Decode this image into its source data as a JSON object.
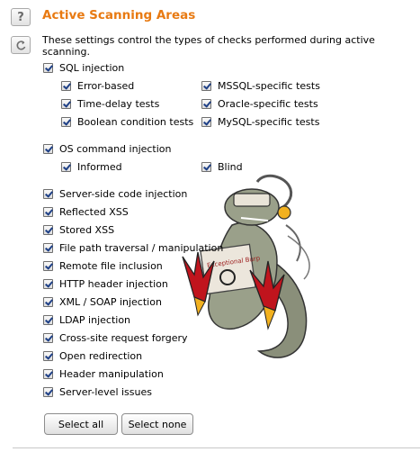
{
  "icons": {
    "help": "question-icon",
    "refresh": "refresh-icon"
  },
  "accent": "#e87a12",
  "title": "Active Scanning Areas",
  "description": "These settings control the types of checks performed during active scanning.",
  "sql": {
    "label": "SQL injection",
    "error_based": "Error-based",
    "time_delay": "Time-delay tests",
    "boolean": "Boolean condition tests",
    "mssql": "MSSQL-specific tests",
    "oracle": "Oracle-specific tests",
    "mysql": "MySQL-specific tests"
  },
  "os": {
    "label": "OS command injection",
    "informed": "Informed",
    "blind": "Blind"
  },
  "items": {
    "server_side": "Server-side code injection",
    "reflected": "Reflected XSS",
    "stored": "Stored XSS",
    "file_path": "File path traversal / manipulation",
    "remote_file": "Remote file inclusion",
    "http_header": "HTTP header injection",
    "xml_soap": "XML / SOAP injection",
    "ldap": "LDAP injection",
    "csrf": "Cross-site request forgery",
    "open_redirect": "Open redirection",
    "header_manip": "Header manipulation",
    "server_level": "Server-level issues"
  },
  "mascot_sign": "Exceptional Burp",
  "buttons": {
    "select_all": "Select all",
    "select_none": "Select none"
  }
}
